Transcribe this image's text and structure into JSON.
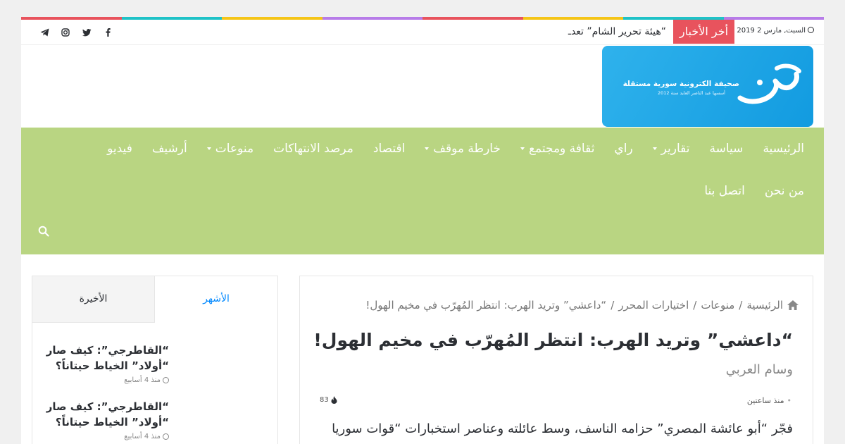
{
  "colors": {
    "rainbow": [
      "#e8535d",
      "#1fc2c7",
      "#f5c518",
      "#b77ce8",
      "#e8535d",
      "#f5c518",
      "#1fc2c7",
      "#b77ce8"
    ],
    "nav_bg": "#b9d582",
    "breaking_bg": "#e8535d",
    "logo_bg": "#1ba4e6",
    "tab_active": "#0088ff"
  },
  "topbar": {
    "date": "السبت, مارس 2 2019",
    "breaking_label": "أخر الأخبار",
    "ticker_text": "“هيئة تحرير الشام” تعدـ",
    "socials": [
      "facebook-icon",
      "twitter-icon",
      "instagram-icon",
      "telegram-icon"
    ]
  },
  "logo": {
    "wordmark": "جسر",
    "tagline": "صحيفة الكترونية سورية مستقلة",
    "subline": "أسسها عبد الناصر العايد سنة 2012"
  },
  "nav": {
    "row1": [
      {
        "label": "الرئيسية",
        "dropdown": false
      },
      {
        "label": "سياسة",
        "dropdown": false
      },
      {
        "label": "تقارير",
        "dropdown": true
      },
      {
        "label": "راي",
        "dropdown": false
      },
      {
        "label": "ثقافة ومجتمع",
        "dropdown": true
      },
      {
        "label": "خارطة موقف",
        "dropdown": true
      },
      {
        "label": "اقتصاد",
        "dropdown": false
      },
      {
        "label": "مرصد الانتهاكات",
        "dropdown": false
      },
      {
        "label": "منوعات",
        "dropdown": true
      },
      {
        "label": "أرشيف",
        "dropdown": false
      },
      {
        "label": "فيديو",
        "dropdown": false
      }
    ],
    "row2": [
      {
        "label": "من نحن",
        "dropdown": false
      },
      {
        "label": "اتصل بنا",
        "dropdown": false
      }
    ]
  },
  "article": {
    "breadcrumb": [
      "الرئيسية",
      "منوعات",
      "اختيارات المحرر",
      "“داعشي” وتريد الهرب: انتظر المُهرّب في مخيم الهول!"
    ],
    "breadcrumb_sep": "/",
    "title": "“داعشي” وتريد الهرب: انتظر المُهرّب في مخيم الهول!",
    "author": "وسام العربي",
    "time": "منذ ساعتين",
    "views": "83",
    "excerpt": "فجّر “أبو عائشة المصري” حزامه الناسف، وسط عائلته وعناصر استخبارات “قوات سوريا"
  },
  "sidebar": {
    "tabs": {
      "popular": "الأشهر",
      "recent": "الأخيرة"
    },
    "posts": [
      {
        "line1": "“القاطرجي”: كيف صار",
        "line2": "“أولاد” الخياط حيتاناً؟",
        "date": "منذ 4 أسابيع"
      },
      {
        "line1": "“القاطرجي”: كيف صار",
        "line2": "“أولاد” الخياط حيتاناً؟",
        "date": "منذ 4 أسابيع"
      }
    ]
  }
}
